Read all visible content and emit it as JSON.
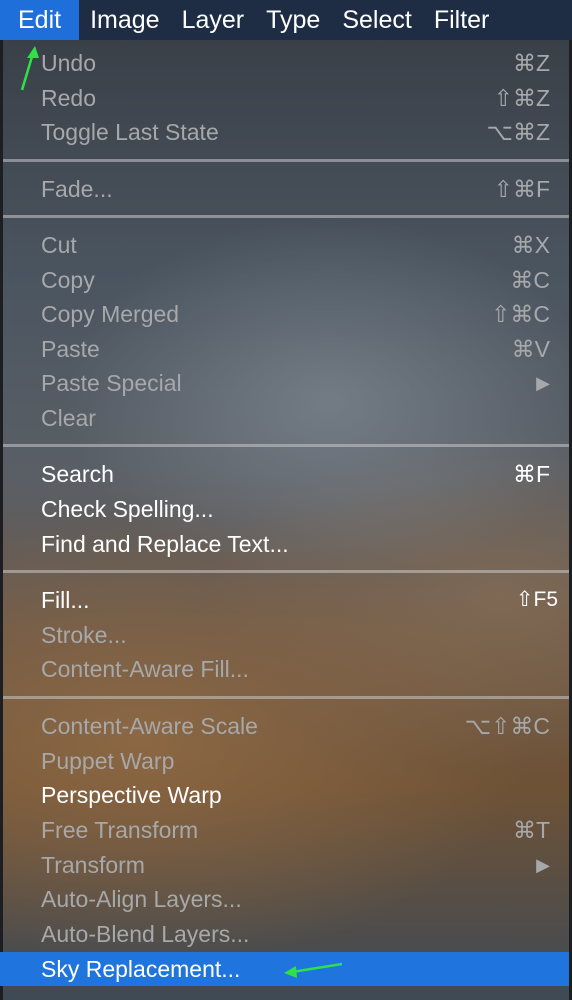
{
  "menubar": {
    "items": [
      "Edit",
      "Image",
      "Layer",
      "Type",
      "Select",
      "Filter"
    ]
  },
  "menu": {
    "items": [
      {
        "label": "Undo",
        "shortcut": "⌘Z"
      },
      {
        "label": "Redo",
        "shortcut": "⇧⌘Z"
      },
      {
        "label": "Toggle Last State",
        "shortcut": "⌥⌘Z"
      },
      {
        "label": "Fade...",
        "shortcut": "⇧⌘F"
      },
      {
        "label": "Cut",
        "shortcut": "⌘X"
      },
      {
        "label": "Copy",
        "shortcut": "⌘C"
      },
      {
        "label": "Copy Merged",
        "shortcut": "⇧⌘C"
      },
      {
        "label": "Paste",
        "shortcut": "⌘V"
      },
      {
        "label": "Paste Special",
        "shortcut": "▶"
      },
      {
        "label": "Clear",
        "shortcut": ""
      },
      {
        "label": "Search",
        "shortcut": "⌘F"
      },
      {
        "label": "Check Spelling...",
        "shortcut": ""
      },
      {
        "label": "Find and Replace Text...",
        "shortcut": ""
      },
      {
        "label": "Fill...",
        "shortcut": "⇧F5"
      },
      {
        "label": "Stroke...",
        "shortcut": ""
      },
      {
        "label": "Content-Aware Fill...",
        "shortcut": ""
      },
      {
        "label": "Content-Aware Scale",
        "shortcut": "⌥⇧⌘C"
      },
      {
        "label": "Puppet Warp",
        "shortcut": ""
      },
      {
        "label": "Perspective Warp",
        "shortcut": ""
      },
      {
        "label": "Free Transform",
        "shortcut": "⌘T"
      },
      {
        "label": "Transform",
        "shortcut": "▶"
      },
      {
        "label": "Auto-Align Layers...",
        "shortcut": ""
      },
      {
        "label": "Auto-Blend Layers...",
        "shortcut": ""
      },
      {
        "label": "Sky Replacement...",
        "shortcut": ""
      }
    ]
  },
  "colors": {
    "menubar_bg": "#1f2d44",
    "highlight": "#1f74dd",
    "annotation_arrow": "#2ee04a"
  }
}
